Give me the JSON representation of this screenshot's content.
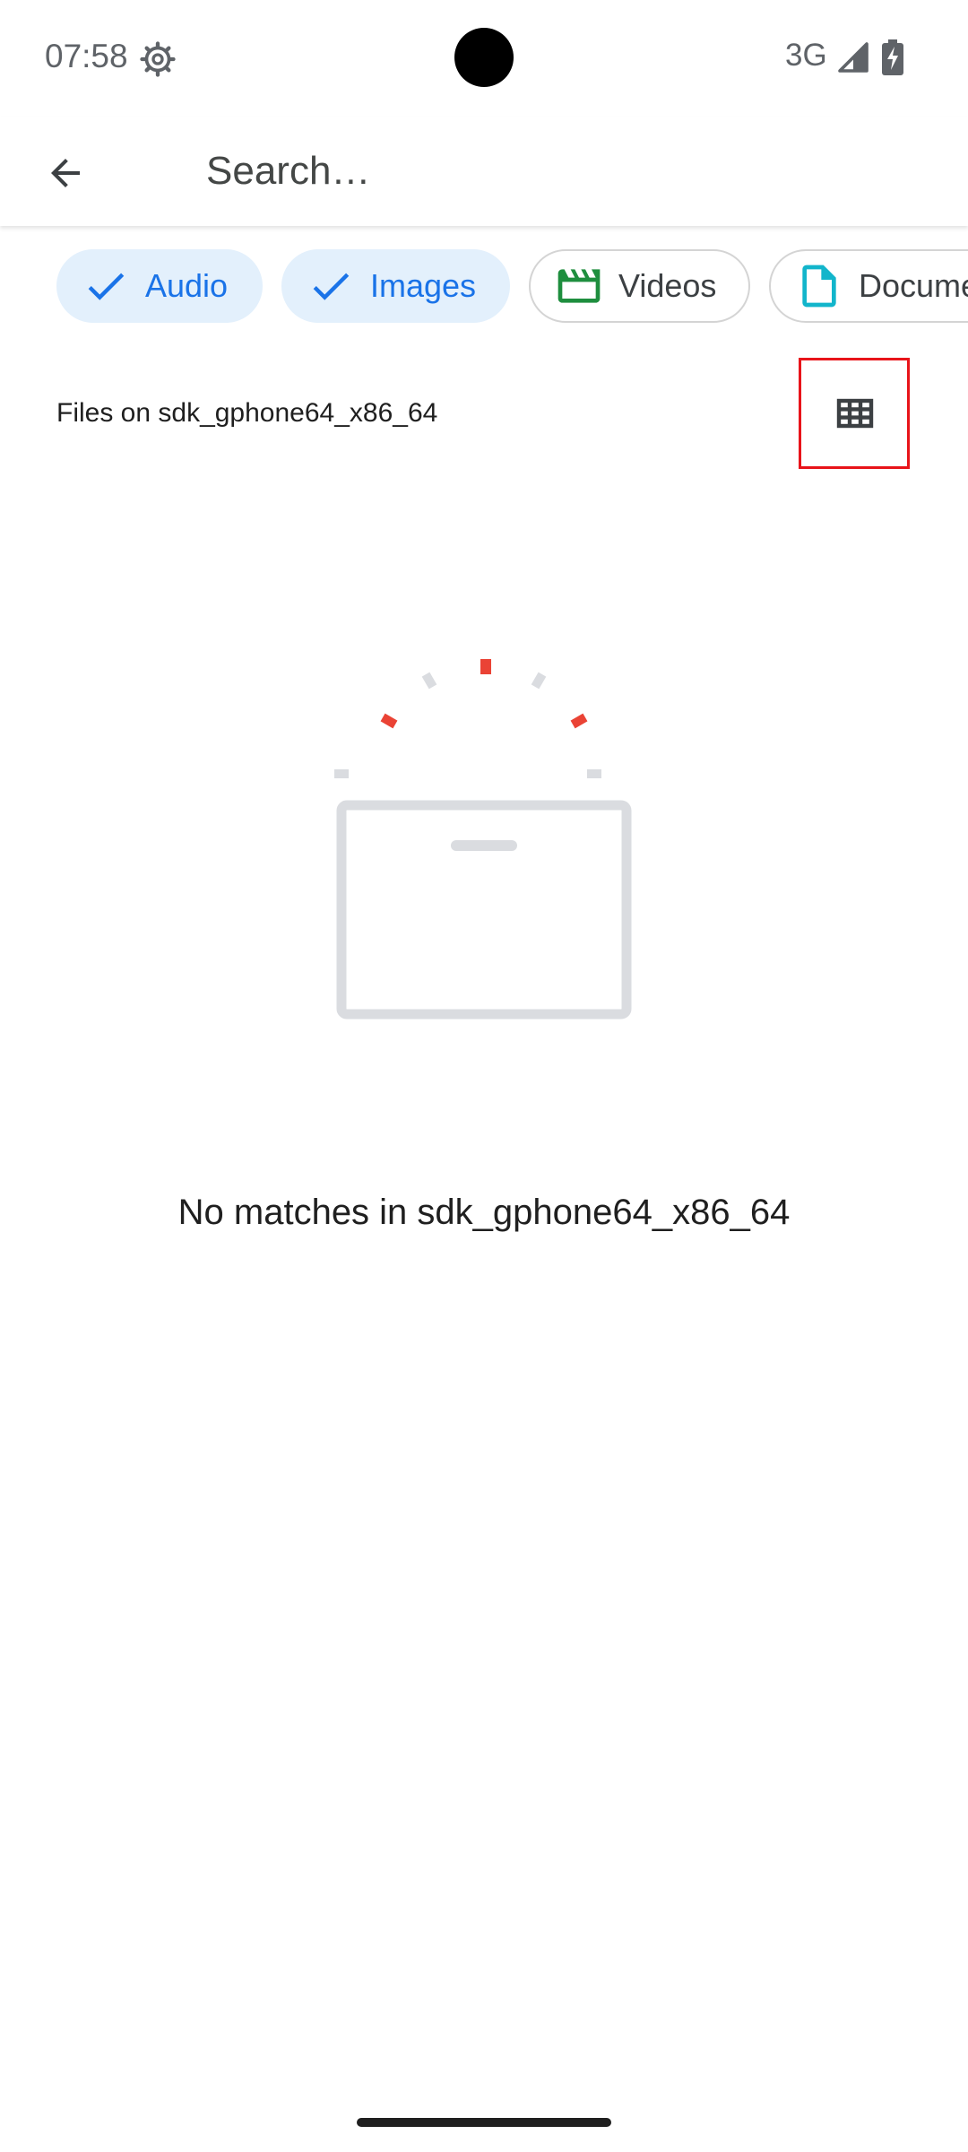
{
  "status_bar": {
    "time": "07:58",
    "network": "3G",
    "icons": [
      "gear-icon",
      "signal-icon",
      "battery-charging-icon"
    ]
  },
  "app_bar": {
    "back_icon": "arrow-back-icon",
    "search_placeholder": "Search…"
  },
  "chips": [
    {
      "label": "Audio",
      "selected": true,
      "icon": "check-icon"
    },
    {
      "label": "Images",
      "selected": true,
      "icon": "check-icon"
    },
    {
      "label": "Videos",
      "selected": false,
      "icon": "video-icon"
    },
    {
      "label": "Documents",
      "selected": false,
      "icon": "document-icon"
    }
  ],
  "section": {
    "title": "Files on sdk_gphone64_x86_64",
    "view_toggle_icon": "grid-view-icon"
  },
  "empty_state": {
    "message": "No matches in sdk_gphone64_x86_64",
    "icon": "empty-box-icon"
  },
  "colors": {
    "accent": "#1a73e8",
    "chip_selected_bg": "#e3f0fc",
    "video_icon": "#1e8e3e",
    "document_icon": "#12b5cb",
    "illustration_red": "#ea4335",
    "illustration_gray": "#dadce0",
    "highlight": "#e8141a"
  }
}
